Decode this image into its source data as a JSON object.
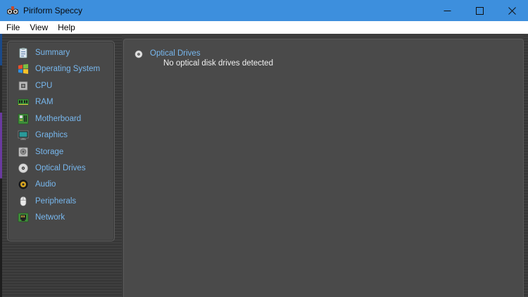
{
  "window": {
    "title": "Piriform Speccy",
    "controls": {
      "minimize_icon": "minimize-icon",
      "maximize_icon": "maximize-icon",
      "close_icon": "close-icon"
    }
  },
  "menu": {
    "items": [
      "File",
      "View",
      "Help"
    ]
  },
  "sidebar": {
    "items": [
      {
        "label": "Summary",
        "icon": "summary-icon"
      },
      {
        "label": "Operating System",
        "icon": "windows-logo-icon"
      },
      {
        "label": "CPU",
        "icon": "cpu-chip-icon"
      },
      {
        "label": "RAM",
        "icon": "ram-module-icon"
      },
      {
        "label": "Motherboard",
        "icon": "motherboard-icon"
      },
      {
        "label": "Graphics",
        "icon": "monitor-icon"
      },
      {
        "label": "Storage",
        "icon": "hard-drive-icon"
      },
      {
        "label": "Optical Drives",
        "icon": "optical-disc-icon"
      },
      {
        "label": "Audio",
        "icon": "speaker-icon"
      },
      {
        "label": "Peripherals",
        "icon": "mouse-icon"
      },
      {
        "label": "Network",
        "icon": "network-icon"
      }
    ]
  },
  "content": {
    "section_title": "Optical Drives",
    "section_icon": "optical-disc-icon",
    "message": "No optical disk drives detected"
  },
  "colors": {
    "titlebar": "#3d8fdd",
    "link_text": "#78b8ef",
    "body_text": "#f0f0f0",
    "panel_bg": "#4a4a4a"
  }
}
